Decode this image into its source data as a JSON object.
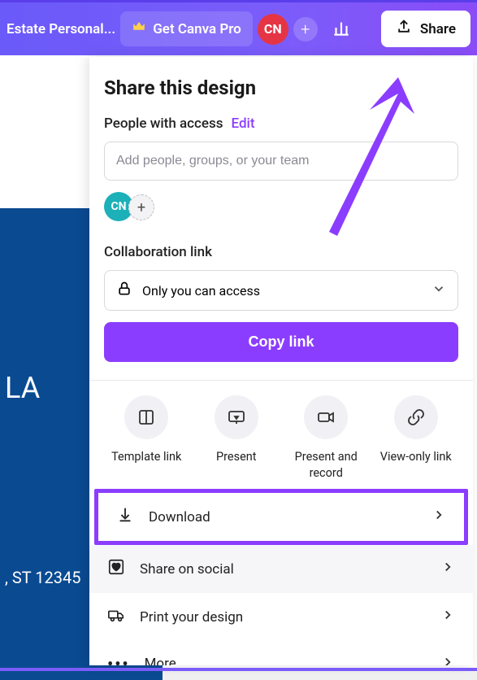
{
  "topbar": {
    "doc_title": "Estate Personal...",
    "pro_label": "Get Canva Pro",
    "avatar_initials": "CN",
    "share_label": "Share"
  },
  "canvas": {
    "la_text": "LA",
    "addr_text": ", ST 12345"
  },
  "share_panel": {
    "title": "Share this design",
    "people_label": "People with access",
    "edit_label": "Edit",
    "people_placeholder": "Add people, groups, or your team",
    "avatar_initials": "CN",
    "collab_label": "Collaboration link",
    "collab_value": "Only you can access",
    "copy_label": "Copy link",
    "options": [
      {
        "name": "template-link",
        "label": "Template link"
      },
      {
        "name": "present",
        "label": "Present"
      },
      {
        "name": "present-record",
        "label": "Present and record"
      },
      {
        "name": "view-only",
        "label": "View-only link"
      }
    ],
    "menu": {
      "download": "Download",
      "share_social": "Share on social",
      "print": "Print your design",
      "more": "More"
    }
  },
  "colors": {
    "accent": "#8b3dff",
    "topbar_start": "#6a5af9",
    "topbar_end": "#8a4cf7",
    "avatar_red": "#e53545",
    "avatar_cyan": "#1cb0b8",
    "doc_blue": "#0a4a91"
  }
}
